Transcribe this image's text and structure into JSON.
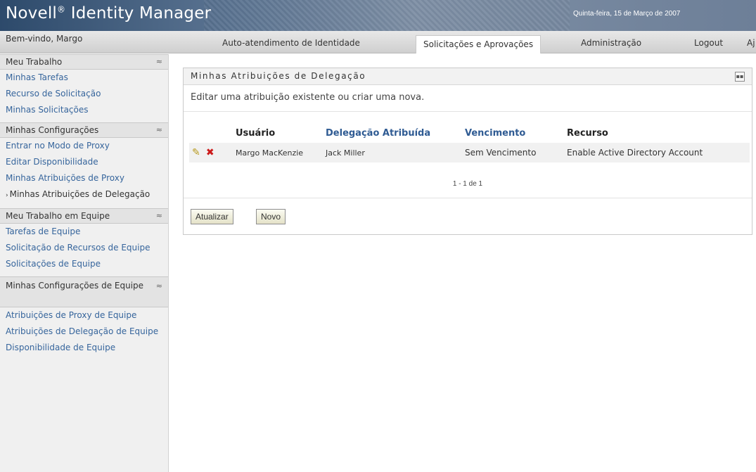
{
  "header": {
    "brand": "Novell",
    "brand_mark": "®",
    "brand_suffix": "Identity Manager",
    "date": "Quinta-feira, 15 de Março de 2007"
  },
  "nav": {
    "welcome": "Bem-vindo, Margo",
    "tabs": [
      {
        "label": "Auto-atendimento de Identidade"
      },
      {
        "label": "Solicitações e Aprovações"
      },
      {
        "label": "Administração"
      },
      {
        "label": "Logout"
      },
      {
        "label": "Aj"
      }
    ]
  },
  "sidebar": {
    "sections": [
      {
        "title": "Meu Trabalho",
        "items": [
          "Minhas Tarefas",
          "Recurso de Solicitação",
          "Minhas Solicitações"
        ]
      },
      {
        "title": "Minhas Configurações",
        "items": [
          "Entrar no Modo de Proxy",
          "Editar Disponibilidade",
          "Minhas Atribuições de Proxy",
          "Minhas Atribuições de Delegação"
        ]
      },
      {
        "title": "Meu Trabalho em Equipe",
        "items": [
          "Tarefas de Equipe",
          "Solicitação de Recursos de Equipe",
          "Solicitações de Equipe"
        ]
      },
      {
        "title": "Minhas Configurações de Equipe",
        "items": [
          "Atribuições de Proxy de Equipe",
          "Atribuições de Delegação de Equipe",
          "Disponibilidade de Equipe"
        ]
      }
    ],
    "collapse_glyph": "≈"
  },
  "panel": {
    "title": "Minhas Atribuições de Delegação",
    "description": "Editar uma atribuição existente ou criar uma nova.",
    "columns": [
      "Usuário",
      "Delegação Atribuída",
      "Vencimento",
      "Recurso"
    ],
    "rows": [
      {
        "user": "Margo MacKenzie",
        "delegate": "Jack Miller",
        "expiration": "Sem Vencimento",
        "resource": "Enable Active Directory Account"
      }
    ],
    "pager": "1 - 1 de 1",
    "refresh_label": "Atualizar",
    "new_label": "Novo"
  }
}
